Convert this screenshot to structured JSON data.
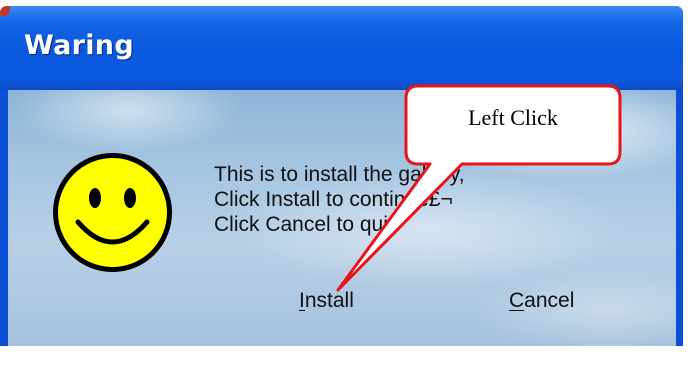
{
  "window": {
    "title": "Waring"
  },
  "dialog": {
    "message_lines": [
      "This is to install the gallery,",
      "Click Install to continue£¬",
      "Click Cancel to quit."
    ],
    "icon": "smiley-face-icon",
    "buttons": {
      "install": {
        "accel": "I",
        "rest": "nstall"
      },
      "cancel": {
        "accel": "C",
        "rest": "ancel"
      }
    }
  },
  "annotation": {
    "label": "Left Click",
    "fill": "#ffffff",
    "stroke": "#e8141c"
  },
  "colors": {
    "titlebar": "#0a58dc",
    "smiley_fill": "#ffff00",
    "smiley_outline": "#000000"
  }
}
